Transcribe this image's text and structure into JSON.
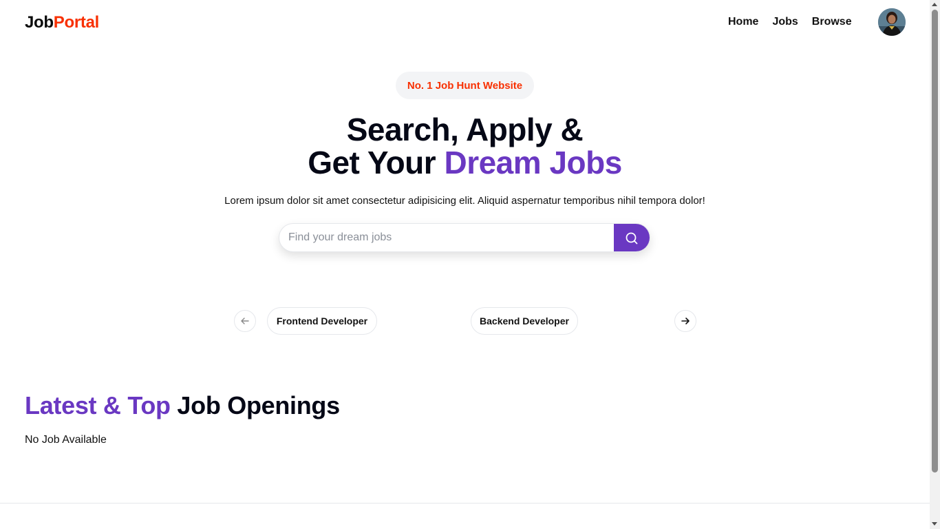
{
  "navbar": {
    "logo_part1": "Job",
    "logo_part2": "Portal",
    "links": [
      "Home",
      "Jobs",
      "Browse"
    ],
    "avatar_icon": "user-avatar"
  },
  "hero": {
    "badge": "No. 1 Job Hunt Website",
    "title_line1": "Search, Apply &",
    "title_line2_plain": "Get Your ",
    "title_line2_accent": "Dream Jobs",
    "description": "Lorem ipsum dolor sit amet consectetur adipisicing elit. Aliquid aspernatur temporibus nihil tempora dolor!",
    "search": {
      "placeholder": "Find your dream jobs",
      "value": "",
      "button_icon": "search-icon"
    }
  },
  "carousel": {
    "prev_icon": "arrow-left-icon",
    "next_icon": "arrow-right-icon",
    "items": [
      "Frontend Developer",
      "Backend Developer"
    ]
  },
  "latest": {
    "title_accent": "Latest & Top",
    "title_plain": " Job Openings",
    "empty_text": "No Job Available"
  },
  "colors": {
    "brand_red": "#f83002",
    "brand_purple": "#6a38c2",
    "text_dark": "#050816"
  }
}
